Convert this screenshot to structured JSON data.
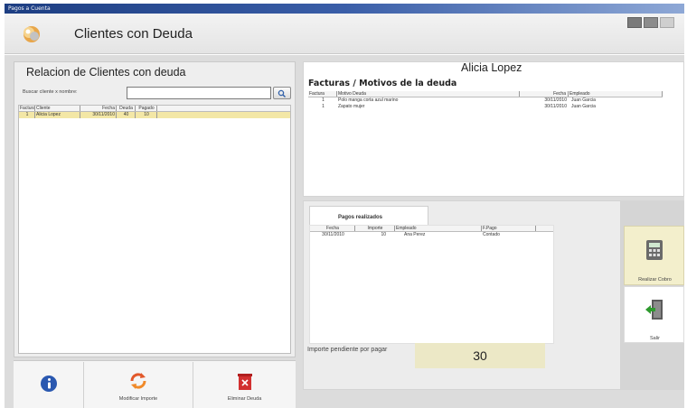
{
  "window": {
    "title": "Pagos a Cuenta"
  },
  "header": {
    "title": "Clientes con Deuda"
  },
  "left": {
    "title": "Relacion de Clientes con deuda",
    "search_label": "Buscar cliente x nombre:",
    "search_value": "",
    "columns": [
      "Factura",
      "Cliente",
      "Fecha",
      "Deuda",
      "Pagado"
    ],
    "rows": [
      {
        "factura": "1",
        "cliente": "Alicia Lopez",
        "fecha": "30/11/2010",
        "deuda": "40",
        "pagado": "10"
      }
    ]
  },
  "toolbar": {
    "info_label": "",
    "modify_label": "Modificar Importe",
    "delete_label": "Eliminar Deuda"
  },
  "detail": {
    "client_name": "Alicia Lopez",
    "facturas_title": "Facturas / Motivos de la deuda",
    "columns": [
      "Factura",
      "Motivo Deuda",
      "Fecha",
      "Empleado"
    ],
    "rows": [
      {
        "factura": "1",
        "motivo": "Polo manga corta azul marino",
        "fecha": "30/11/2010",
        "empleado": "Juan Garcia"
      },
      {
        "factura": "1",
        "motivo": "Zapato mujer",
        "fecha": "30/11/2010",
        "empleado": "Juan Garcia"
      }
    ]
  },
  "payments": {
    "tab_label": "Pagos realizados",
    "columns": [
      "Fecha",
      "Importe",
      "Empleado",
      "F.Pago"
    ],
    "rows": [
      {
        "fecha": "30/11/2010",
        "importe": "10",
        "empleado": "Ana Perez",
        "fpago": "Contado"
      }
    ],
    "pending_label": "Importe pendiente por pagar",
    "pending_value": "30"
  },
  "side": {
    "cobro_label": "Realizar Cobro",
    "salir_label": "Salir"
  },
  "colors": {
    "selected_row": "#f3e7a6",
    "pending_box": "#ece8c6",
    "titlebar": "#1d3e82"
  }
}
